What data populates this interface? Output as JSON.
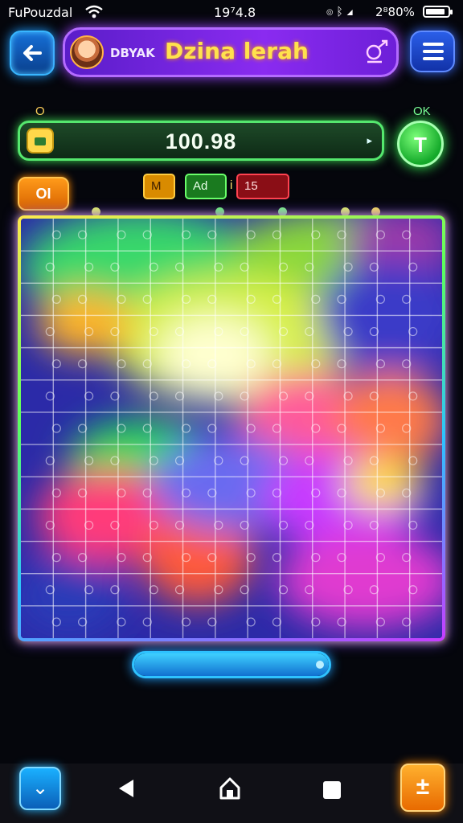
{
  "status_bar": {
    "carrier": "FuPouzdal",
    "time": "19⁷4.8",
    "battery_percent": "2⁸80%",
    "battery_level": 0.9,
    "icons": [
      "wifi-icon",
      "alarm-icon",
      "bluetooth-icon",
      "signal-icon",
      "battery-icon"
    ]
  },
  "header": {
    "subtitle": "DBYAK",
    "title": "Dzina lerah",
    "icons": [
      "back-arrow-icon",
      "avatar",
      "edit-pin-icon",
      "menu-icon"
    ]
  },
  "score": {
    "left_label": "O",
    "right_label": "OK",
    "value": "100.98",
    "action_label": "T"
  },
  "badges": {
    "level": "OI",
    "tab_m": "M",
    "tab_a": "Ad",
    "tab_sep": "i",
    "tab_n": "15"
  },
  "board": {
    "rows": 13,
    "cols": 13
  },
  "progress": {
    "fraction": 1.0
  },
  "nav": {
    "left_icon": "chevron-down-icon",
    "back_icon": "back-triangle-icon",
    "home_icon": "home-icon",
    "recent_icon": "recent-square-icon",
    "right_icon": "plus-icon",
    "left_glyph": "⌄",
    "right_glyph": "±"
  },
  "colors": {
    "accent_purple": "#8a2bf0",
    "accent_green": "#55e86e",
    "accent_blue": "#2ec2ff",
    "accent_orange": "#ff9a1a",
    "title_yellow": "#ffe14d"
  }
}
